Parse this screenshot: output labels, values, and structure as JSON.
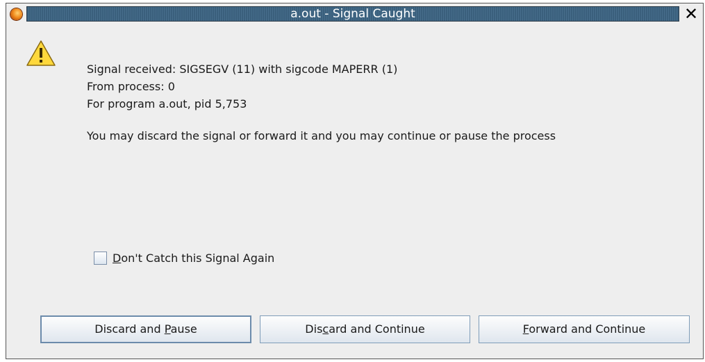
{
  "window": {
    "title": "a.out - Signal Caught",
    "close_glyph": "✕",
    "app_icon": "app-logo-icon"
  },
  "message": {
    "icon": "warning-icon",
    "lines": [
      "Signal received: SIGSEGV (11) with sigcode MAPERR (1)",
      "From process: 0",
      "For program a.out, pid 5,753"
    ],
    "detail": "You may discard the signal or forward it and you may continue or pause the process"
  },
  "checkbox": {
    "label_mnemonic": "D",
    "label_rest": "on't Catch this Signal Again",
    "checked": false
  },
  "buttons": {
    "discard_pause": {
      "pre": "Discard and ",
      "mnemonic": "P",
      "post": "ause"
    },
    "discard_continue": {
      "pre": "Dis",
      "mnemonic": "c",
      "post": "ard and Continue"
    },
    "forward_continue": {
      "pre": "",
      "mnemonic": "F",
      "post": "orward and Continue"
    }
  },
  "colors": {
    "title_bar": "#3a5f7c",
    "warning_fill": "#ffd83c",
    "button_border": "#7f9db9"
  }
}
